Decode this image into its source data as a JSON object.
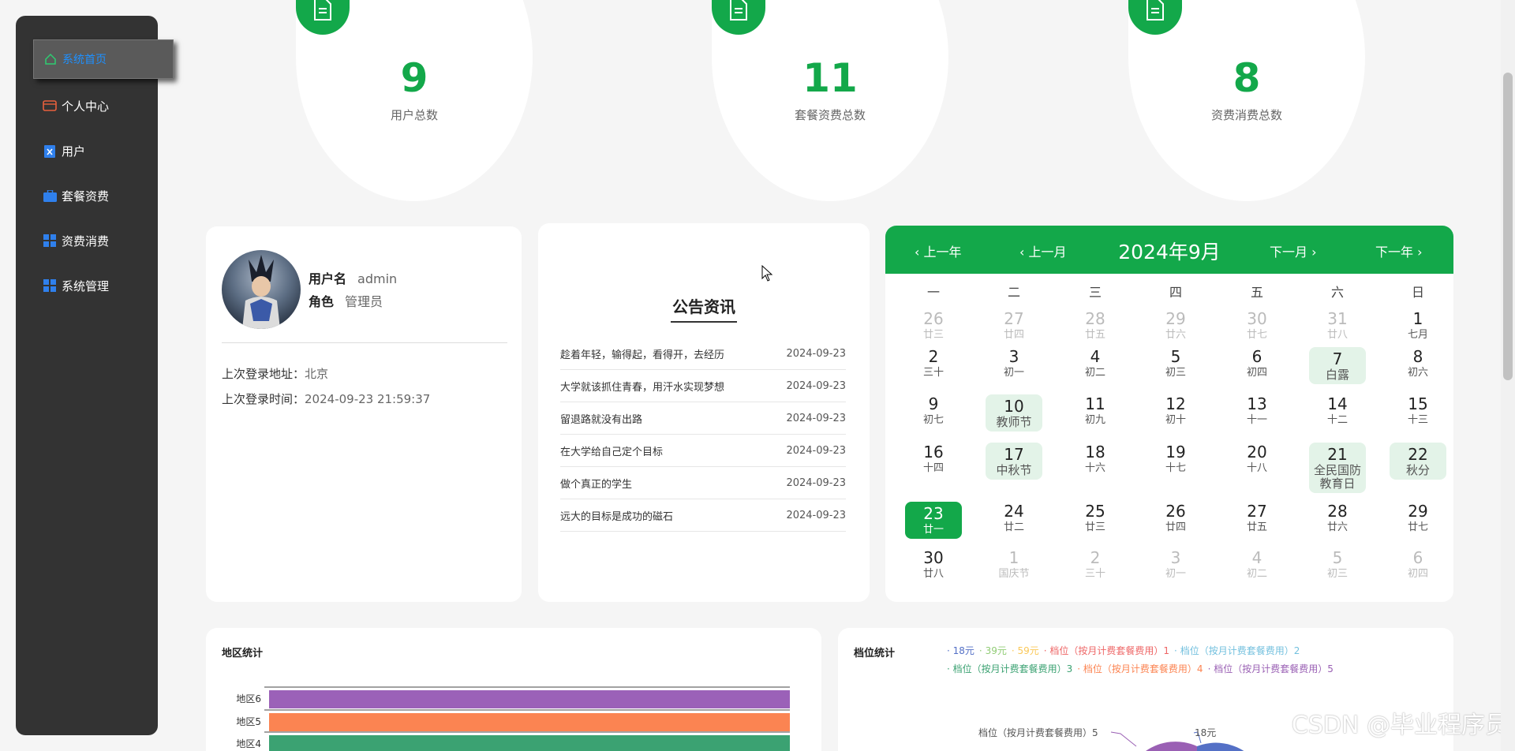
{
  "sidebar": {
    "items": [
      {
        "label": "系统首页",
        "icon": "home-icon",
        "active": true
      },
      {
        "label": "个人中心",
        "icon": "wallet-icon"
      },
      {
        "label": "用户",
        "icon": "user-clipboard-icon"
      },
      {
        "label": "套餐资费",
        "icon": "briefcase-icon"
      },
      {
        "label": "资费消费",
        "icon": "grid-icon"
      },
      {
        "label": "系统管理",
        "icon": "grid-icon"
      }
    ]
  },
  "stats": [
    {
      "value": "9",
      "label": "用户总数",
      "icon": "document-icon"
    },
    {
      "value": "11",
      "label": "套餐资费总数",
      "icon": "document-icon"
    },
    {
      "value": "8",
      "label": "资费消费总数",
      "icon": "document-icon"
    }
  ],
  "user": {
    "username_label": "用户名",
    "username": "admin",
    "role_label": "角色",
    "role": "管理员",
    "last_addr_label": "上次登录地址：",
    "last_addr": "北京",
    "last_time_label": "上次登录时间：",
    "last_time": "2024-09-23 21:59:37"
  },
  "notice": {
    "title": "公告资讯",
    "items": [
      {
        "text": "趁着年轻，输得起，看得开，去经历",
        "date": "2024-09-23"
      },
      {
        "text": "大学就该抓住青春，用汗水实现梦想",
        "date": "2024-09-23"
      },
      {
        "text": "留退路就没有出路",
        "date": "2024-09-23"
      },
      {
        "text": "在大学给自己定个目标",
        "date": "2024-09-23"
      },
      {
        "text": "做个真正的学生",
        "date": "2024-09-23"
      },
      {
        "text": "远大的目标是成功的磁石",
        "date": "2024-09-23"
      }
    ]
  },
  "calendar": {
    "title": "2024年9月",
    "prev_year": "上一年",
    "prev_month": "上一月",
    "next_month": "下一月",
    "next_year": "下一年",
    "weekdays": [
      "一",
      "二",
      "三",
      "四",
      "五",
      "六",
      "日"
    ],
    "rows": [
      [
        {
          "d": "26",
          "l": "廿三",
          "o": 1
        },
        {
          "d": "27",
          "l": "廿四",
          "o": 1
        },
        {
          "d": "28",
          "l": "廿五",
          "o": 1
        },
        {
          "d": "29",
          "l": "廿六",
          "o": 1
        },
        {
          "d": "30",
          "l": "廿七",
          "o": 1
        },
        {
          "d": "31",
          "l": "廿八",
          "o": 1
        },
        {
          "d": "1",
          "l": "七月"
        }
      ],
      [
        {
          "d": "2",
          "l": "三十"
        },
        {
          "d": "3",
          "l": "初一"
        },
        {
          "d": "4",
          "l": "初二"
        },
        {
          "d": "5",
          "l": "初三"
        },
        {
          "d": "6",
          "l": "初四"
        },
        {
          "d": "7",
          "l": "白露",
          "f": 1
        },
        {
          "d": "8",
          "l": "初六"
        }
      ],
      [
        {
          "d": "9",
          "l": "初七"
        },
        {
          "d": "10",
          "l": "教师节",
          "f": 1
        },
        {
          "d": "11",
          "l": "初九"
        },
        {
          "d": "12",
          "l": "初十"
        },
        {
          "d": "13",
          "l": "十一"
        },
        {
          "d": "14",
          "l": "十二"
        },
        {
          "d": "15",
          "l": "十三"
        }
      ],
      [
        {
          "d": "16",
          "l": "十四"
        },
        {
          "d": "17",
          "l": "中秋节",
          "f": 1
        },
        {
          "d": "18",
          "l": "十六"
        },
        {
          "d": "19",
          "l": "十七"
        },
        {
          "d": "20",
          "l": "十八"
        },
        {
          "d": "21",
          "l": "全民国防教育日",
          "f": 1
        },
        {
          "d": "22",
          "l": "秋分",
          "f": 1
        }
      ],
      [
        {
          "d": "23",
          "l": "廿一",
          "t": 1
        },
        {
          "d": "24",
          "l": "廿二"
        },
        {
          "d": "25",
          "l": "廿三"
        },
        {
          "d": "26",
          "l": "廿四"
        },
        {
          "d": "27",
          "l": "廿五"
        },
        {
          "d": "28",
          "l": "廿六"
        },
        {
          "d": "29",
          "l": "廿七"
        }
      ],
      [
        {
          "d": "30",
          "l": "廿八"
        },
        {
          "d": "1",
          "l": "国庆节",
          "o": 1
        },
        {
          "d": "2",
          "l": "三十",
          "o": 1
        },
        {
          "d": "3",
          "l": "初一",
          "o": 1
        },
        {
          "d": "4",
          "l": "初二",
          "o": 1
        },
        {
          "d": "5",
          "l": "初三",
          "o": 1
        },
        {
          "d": "6",
          "l": "初四",
          "o": 1
        }
      ]
    ]
  },
  "region_chart": {
    "title": "地区统计",
    "chart_data": {
      "type": "bar",
      "orientation": "horizontal",
      "categories": [
        "地区6",
        "地区5",
        "地区4"
      ],
      "values": [
        1,
        1,
        1
      ],
      "colors": [
        "#9b61b8",
        "#fb8452",
        "#3ba272"
      ]
    }
  },
  "level_chart": {
    "title": "档位统计",
    "chart_data": {
      "type": "pie",
      "legend": [
        {
          "name": "18元",
          "color": "#5470c6"
        },
        {
          "name": "39元",
          "color": "#91cc75"
        },
        {
          "name": "59元",
          "color": "#fac858"
        },
        {
          "name": "档位（按月计费套餐费用）1",
          "color": "#ee6666"
        },
        {
          "name": "档位（按月计费套餐费用）2",
          "color": "#73c0de"
        },
        {
          "name": "档位（按月计费套餐费用）3",
          "color": "#3ba272"
        },
        {
          "name": "档位（按月计费套餐费用）4",
          "color": "#fc8452"
        },
        {
          "name": "档位（按月计费套餐费用）5",
          "color": "#9a60b4"
        }
      ],
      "visible_labels": [
        "档位（按月计费套餐费用）5",
        "18元"
      ]
    }
  },
  "watermark": "CSDN @毕业程序员"
}
